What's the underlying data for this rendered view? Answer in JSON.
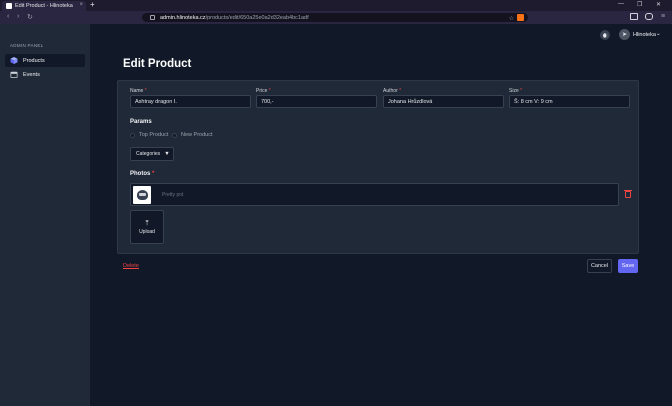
{
  "browser": {
    "tab_title": "Edit Product - Hlinoteka",
    "tab_close": "×",
    "new_tab": "+",
    "url_host": "admin.hlinoteka.cz",
    "url_path": "/products/edit/650a25e0a2d32eab4bc1adf",
    "window_controls": [
      "—",
      "❐",
      "✕"
    ]
  },
  "sidebar": {
    "heading": "ADMIN PANEL",
    "items": [
      {
        "label": "Products",
        "icon": "cube-icon",
        "active": true
      },
      {
        "label": "Events",
        "icon": "calendar-icon",
        "active": false
      }
    ]
  },
  "header": {
    "user_initial": "➤",
    "user_name": "Hlinoteka",
    "user_chevron": "⌄"
  },
  "page": {
    "title": "Edit Product"
  },
  "form": {
    "required_mark": "*",
    "name": {
      "label": "Name",
      "value": "Ashtray dragon I."
    },
    "price": {
      "label": "Price",
      "value": "700,-"
    },
    "author": {
      "label": "Author",
      "value": "Johana Hrůzdlová"
    },
    "size": {
      "label": "Size",
      "value": "Š: 8 cm V: 9 cm"
    },
    "params": {
      "title": "Params",
      "options": [
        "Top Product",
        "New Product"
      ],
      "categories_label": "Categories",
      "categories_caret": "▼"
    },
    "photos": {
      "title": "Photos",
      "items": [
        {
          "placeholder": "Pretty pot"
        }
      ],
      "upload_icon": "⤒",
      "upload_label": "Upload"
    }
  },
  "actions": {
    "delete_label": "Delete",
    "cancel_label": "Cancel",
    "save_label": "Save"
  },
  "colors": {
    "accent": "#6366f1",
    "danger": "#ef4444",
    "background": "#111827",
    "surface": "#1f2937"
  }
}
